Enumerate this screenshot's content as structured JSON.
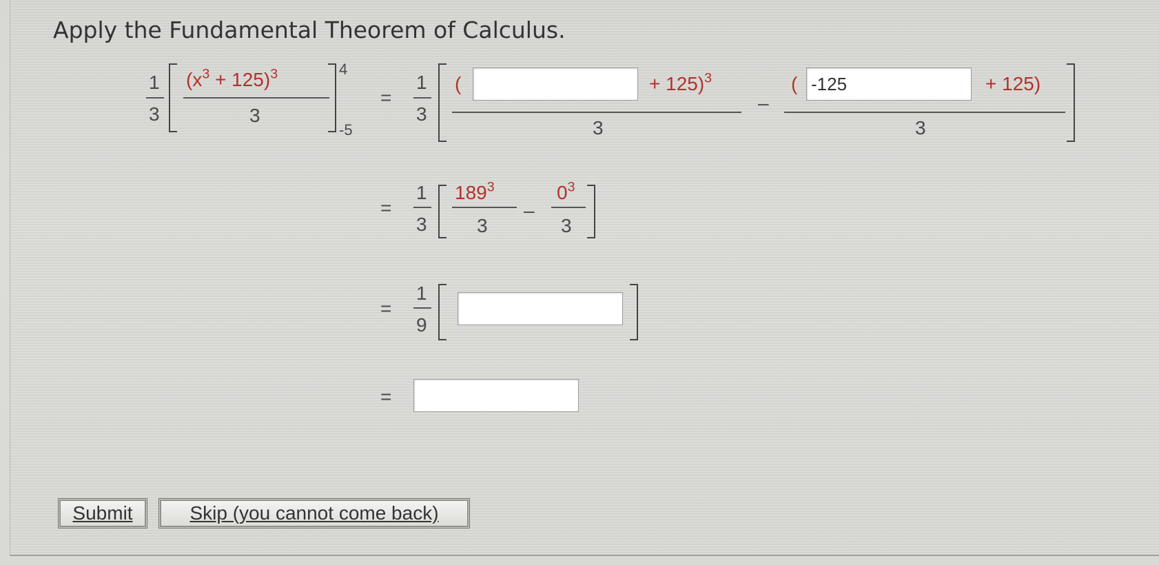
{
  "question": {
    "title": "Apply the Fundamental Theorem of Calculus."
  },
  "lhs": {
    "coef_num": "1",
    "coef_den": "3",
    "expr_open": "(x",
    "expr_exp": "3",
    "expr_plus": " + 125)",
    "expr_outer_exp": "3",
    "denominator": "3",
    "upper_limit": "4",
    "lower_limit": "-5"
  },
  "step1": {
    "equals": "=",
    "coef_num": "1",
    "coef_den": "3",
    "paren_open": "(",
    "plus_term": "+ 125)",
    "plus_exp": "3",
    "denominator1": "3",
    "minus": "–",
    "paren_open2": "(",
    "plus_term2": "+ 125)",
    "denominator2": "3",
    "input1_value": "",
    "input2_value": "-125"
  },
  "step2": {
    "equals": "=",
    "coef_num": "1",
    "coef_den": "3",
    "term1_base": "189",
    "term1_exp": "3",
    "term1_den": "3",
    "minus": "–",
    "term2_base": "0",
    "term2_exp": "3",
    "term2_den": "3"
  },
  "step3": {
    "equals": "=",
    "coef_num": "1",
    "coef_den": "9",
    "input_value": ""
  },
  "step4": {
    "equals": "=",
    "input_value": ""
  },
  "buttons": {
    "submit_label": "Submit",
    "skip_label": "Skip (you cannot come back)"
  },
  "colors": {
    "answer_red": "#b2312c",
    "background": "#d9dad6"
  }
}
